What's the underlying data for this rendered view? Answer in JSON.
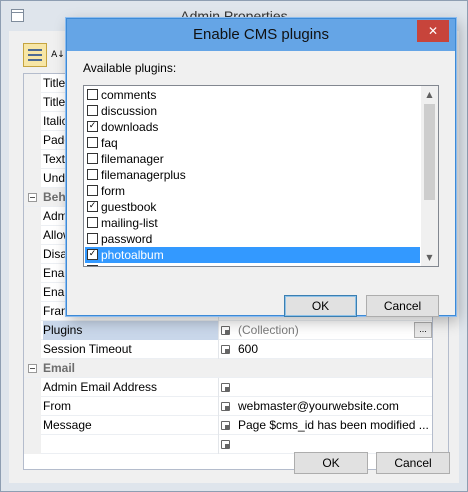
{
  "parent": {
    "title": "Admin Properties",
    "toolbar": {
      "alpha_glyph": "A↓Z"
    },
    "rows": [
      {
        "name": "Title"
      },
      {
        "name": "Title"
      },
      {
        "name": "Italic"
      },
      {
        "name": "Padd"
      },
      {
        "name": "Text"
      },
      {
        "name": "Unde"
      },
      {
        "name": "Beha",
        "category": true
      },
      {
        "name": "Admi"
      },
      {
        "name": "Allow"
      },
      {
        "name": "Disab"
      },
      {
        "name": "Enab"
      },
      {
        "name": "Enab"
      },
      {
        "name": "Fram"
      },
      {
        "name": "Plugins",
        "value": "(Collection)",
        "selected": true,
        "ellipsis": "..."
      },
      {
        "name": "Session Timeout",
        "value": "600"
      },
      {
        "name": "Email",
        "category": true
      },
      {
        "name": "Admin Email Address",
        "value": ""
      },
      {
        "name": "From",
        "value": "webmaster@yourwebsite.com"
      },
      {
        "name": "Message",
        "value": "Page $cms_id has been modified ..."
      },
      {
        "name": "",
        "value": ""
      }
    ],
    "ok_label": "OK",
    "cancel_label": "Cancel"
  },
  "dialog": {
    "title": "Enable CMS plugins",
    "close_glyph": "✕",
    "available_label": "Available plugins:",
    "plugins": [
      {
        "label": "comments",
        "checked": false
      },
      {
        "label": "discussion",
        "checked": false
      },
      {
        "label": "downloads",
        "checked": true
      },
      {
        "label": "faq",
        "checked": false
      },
      {
        "label": "filemanager",
        "checked": false
      },
      {
        "label": "filemanagerplus",
        "checked": false
      },
      {
        "label": "form",
        "checked": false
      },
      {
        "label": "guestbook",
        "checked": true
      },
      {
        "label": "mailing-list",
        "checked": false
      },
      {
        "label": "password",
        "checked": false
      },
      {
        "label": "photoalbum",
        "checked": true,
        "selected": true
      },
      {
        "label": "",
        "checked": false
      }
    ],
    "check_glyph": "✓",
    "scroll_up": "▲",
    "scroll_down": "▼",
    "ok_label": "OK",
    "cancel_label": "Cancel"
  }
}
